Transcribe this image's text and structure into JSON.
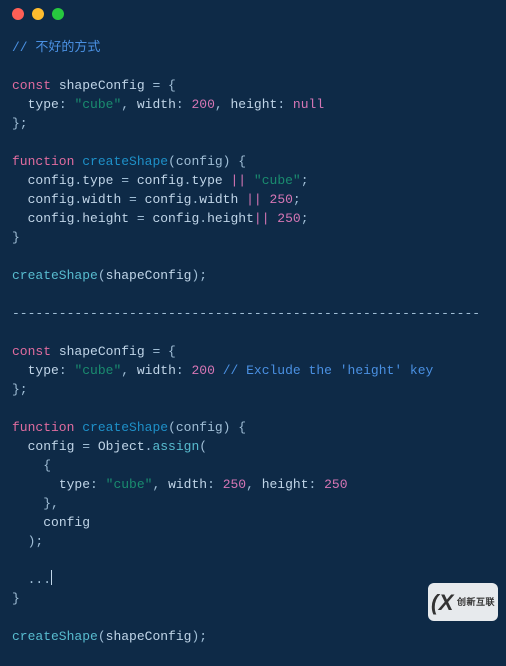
{
  "titlebar": {
    "dots": [
      "red",
      "yellow",
      "green"
    ]
  },
  "code": {
    "comment_bad": "// 不好的方式",
    "kw_const": "const",
    "kw_function": "function",
    "kw_null": "null",
    "id_shapeConfig": "shapeConfig",
    "id_createShape": "createShape",
    "id_config": "config",
    "id_Object": "Object",
    "id_assign": "assign",
    "prop_type": "type",
    "prop_width": "width",
    "prop_height": "height",
    "str_cube": "\"cube\"",
    "num_200": "200",
    "num_250": "250",
    "comment_exclude": "// Exclude the 'height' key",
    "dots": "...",
    "divider": "------------------------------------------------------------",
    "p_eq": " = ",
    "p_open": " = {",
    "p_close": "};",
    "p_brace_close": "}",
    "p_comma_sp": ", ",
    "p_colon": ": ",
    "p_fn_open": "(config) {",
    "p_or": " || ",
    "p_semi": ";",
    "p_dot": ".",
    "p_call_open": "(",
    "p_call_close": ")",
    "p_obrace": "{",
    "p_cbrace": "}",
    "p_cbrace_comma": "},"
  },
  "watermark": {
    "big": "(X",
    "small": "创新互联"
  }
}
